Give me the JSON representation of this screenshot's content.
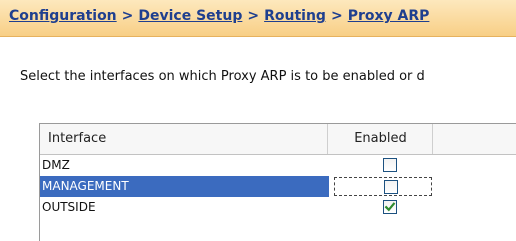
{
  "breadcrumb": {
    "items": [
      "Configuration",
      "Device Setup",
      "Routing",
      "Proxy ARP"
    ],
    "separator": ">"
  },
  "instructions": "Select the interfaces on which Proxy ARP is to be enabled or d",
  "table": {
    "columns": [
      "Interface",
      "Enabled"
    ],
    "rows": [
      {
        "interface": "DMZ",
        "enabled": false
      },
      {
        "interface": "MANAGEMENT",
        "enabled": false,
        "selected": true
      },
      {
        "interface": "OUTSIDE",
        "enabled": true
      }
    ]
  },
  "colors": {
    "selection": "#3b6bbf",
    "check": "#2e8b2e",
    "link": "#1f3f8f"
  }
}
